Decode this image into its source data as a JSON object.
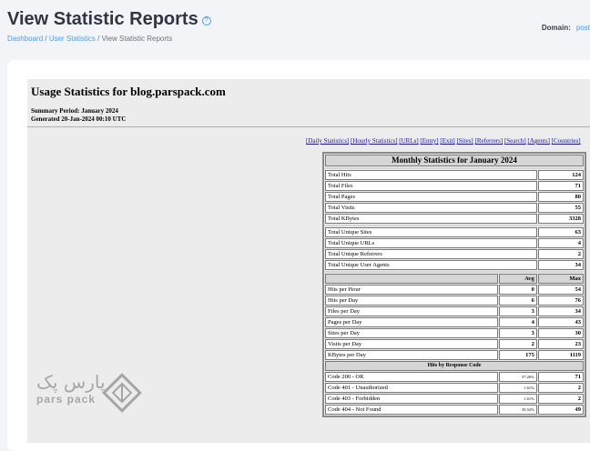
{
  "header": {
    "title": "View Statistic Reports",
    "help_icon": "?",
    "breadcrumb": {
      "dashboard": "Dashboard",
      "sep1": " / ",
      "user_statistics": "User Statistics",
      "sep2": " / ",
      "current": "View Statistic Reports"
    },
    "domain_label": "Domain:",
    "domain_value": "post"
  },
  "report": {
    "title": "Usage Statistics for blog.parspack.com",
    "summary_period": "Summary Period: January 2024",
    "generated": "Generated 20-Jan-2024 00:10 UTC",
    "nav_links": [
      "[Daily Statistics]",
      "[Hourly Statistics]",
      "[URLs]",
      "[Entry]",
      "[Exit]",
      "[Sites]",
      "[Referrers]",
      "[Search]",
      "[Agents]",
      "[Countries]"
    ],
    "monthly_title": "Monthly Statistics for January 2024",
    "totals": [
      {
        "label": "Total Hits",
        "value": "124"
      },
      {
        "label": "Total Files",
        "value": "71"
      },
      {
        "label": "Total Pages",
        "value": "80"
      },
      {
        "label": "Total Visits",
        "value": "55"
      },
      {
        "label": "Total KBytes",
        "value": "3328"
      }
    ],
    "uniques": [
      {
        "label": "Total Unique Sites",
        "value": "63"
      },
      {
        "label": "Total Unique URLs",
        "value": "4"
      },
      {
        "label": "Total Unique Referrers",
        "value": "2"
      },
      {
        "label": "Total Unique User Agents",
        "value": "34"
      }
    ],
    "avg_header": "Avg",
    "max_header": "Max",
    "per_period": [
      {
        "label": "Hits per Hour",
        "avg": "0",
        "max": "54"
      },
      {
        "label": "Hits per Day",
        "avg": "6",
        "max": "76"
      },
      {
        "label": "Files per Day",
        "avg": "3",
        "max": "34"
      },
      {
        "label": "Pages per Day",
        "avg": "4",
        "max": "43"
      },
      {
        "label": "Sites per Day",
        "avg": "3",
        "max": "30"
      },
      {
        "label": "Visits per Day",
        "avg": "2",
        "max": "23"
      },
      {
        "label": "KBytes per Day",
        "avg": "175",
        "max": "1119"
      }
    ],
    "response_title": "Hits by Response Code",
    "response_codes": [
      {
        "label": "Code 200 - OK",
        "pct": "57.26%",
        "value": "71"
      },
      {
        "label": "Code 401 - Unauthorized",
        "pct": "1.61%",
        "value": "2"
      },
      {
        "label": "Code 403 - Forbidden",
        "pct": "1.61%",
        "value": "2"
      },
      {
        "label": "Code 404 - Not Found",
        "pct": "39.52%",
        "value": "49"
      }
    ]
  },
  "watermark": {
    "persian": "پارس پک",
    "latin": "pars pack"
  }
}
